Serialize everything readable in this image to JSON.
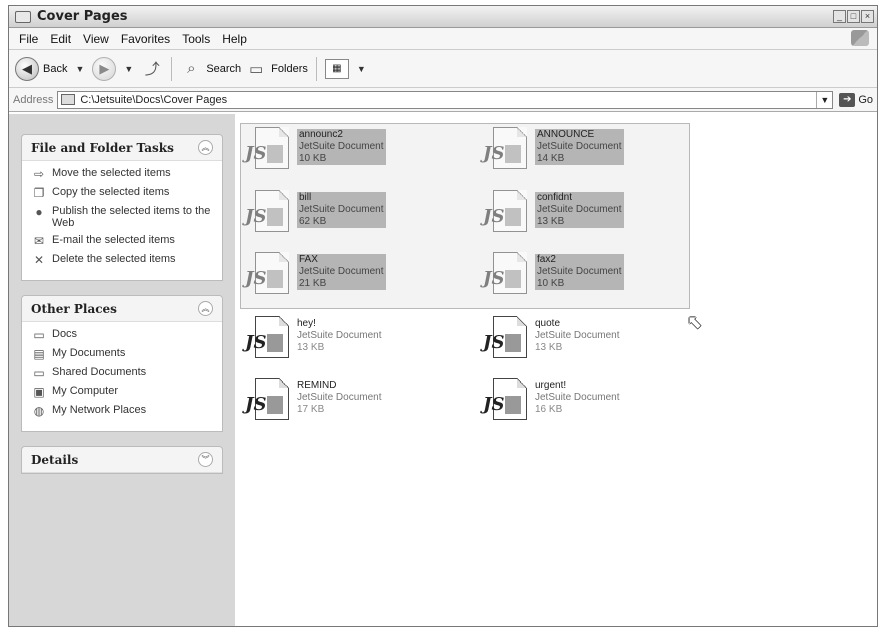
{
  "window": {
    "title": "Cover Pages"
  },
  "menu": [
    "File",
    "Edit",
    "View",
    "Favorites",
    "Tools",
    "Help"
  ],
  "toolbar": {
    "back_label": "Back",
    "search_label": "Search",
    "folders_label": "Folders"
  },
  "address": {
    "label": "Address",
    "path": "C:\\Jetsuite\\Docs\\Cover Pages",
    "go_label": "Go"
  },
  "sidebar": {
    "file_tasks": {
      "title": "File and Folder Tasks",
      "items": [
        "Move the selected items",
        "Copy the selected items",
        "Publish the selected items to the Web",
        "E-mail the selected items",
        "Delete the selected items"
      ]
    },
    "other_places": {
      "title": "Other Places",
      "items": [
        "Docs",
        "My Documents",
        "Shared Documents",
        "My Computer",
        "My Network Places"
      ]
    },
    "details": {
      "title": "Details"
    }
  },
  "files": [
    {
      "name": "announc2",
      "type": "JetSuite Document",
      "size": "10 KB",
      "selected": true
    },
    {
      "name": "ANNOUNCE",
      "type": "JetSuite Document",
      "size": "14 KB",
      "selected": true
    },
    {
      "name": "bill",
      "type": "JetSuite Document",
      "size": "62 KB",
      "selected": true
    },
    {
      "name": "confidnt",
      "type": "JetSuite Document",
      "size": "13 KB",
      "selected": true
    },
    {
      "name": "FAX",
      "type": "JetSuite Document",
      "size": "21 KB",
      "selected": true
    },
    {
      "name": "fax2",
      "type": "JetSuite Document",
      "size": "10 KB",
      "selected": true
    },
    {
      "name": "hey!",
      "type": "JetSuite Document",
      "size": "13 KB",
      "selected": false
    },
    {
      "name": "quote",
      "type": "JetSuite Document",
      "size": "13 KB",
      "selected": false
    },
    {
      "name": "REMIND",
      "type": "JetSuite Document",
      "size": "17 KB",
      "selected": false
    },
    {
      "name": "urgent!",
      "type": "JetSuite Document",
      "size": "16 KB",
      "selected": false
    }
  ]
}
